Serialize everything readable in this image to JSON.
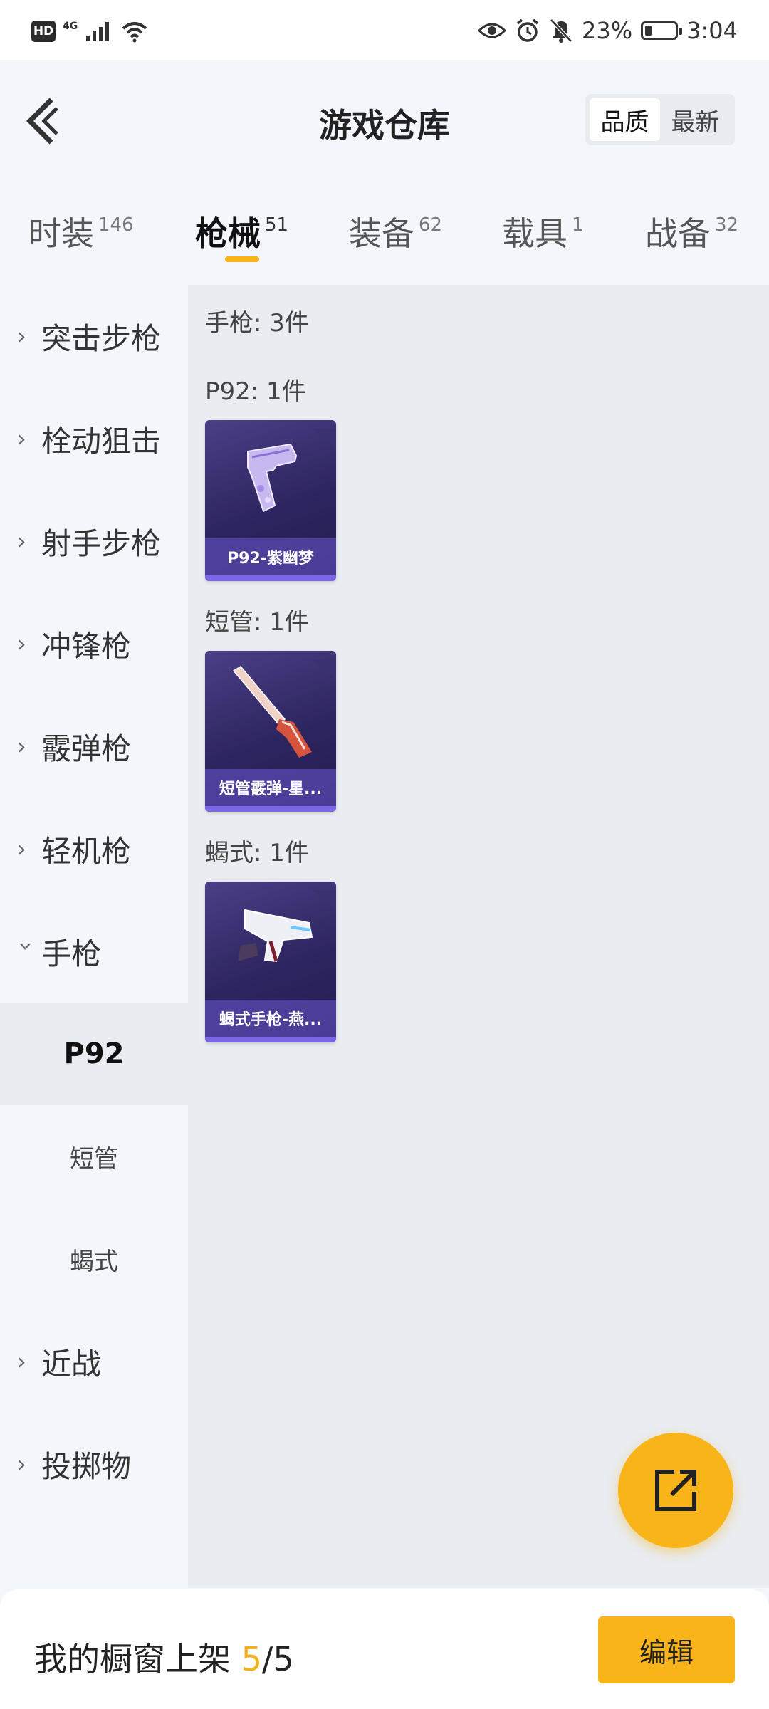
{
  "status_bar": {
    "hd_label": "HD",
    "network_label": "4G",
    "battery_percent": "23%",
    "battery_level": 0.23,
    "time": "3:04",
    "icons": [
      "signal-icon",
      "wifi-icon",
      "eye-icon",
      "alarm-icon",
      "bell-off-icon",
      "battery-icon"
    ]
  },
  "header": {
    "title": "游戏仓库",
    "sort_options": [
      {
        "label": "品质",
        "active": true
      },
      {
        "label": "最新",
        "active": false
      }
    ]
  },
  "tabs": [
    {
      "label": "时装",
      "count": "146",
      "active": false
    },
    {
      "label": "枪械",
      "count": "51",
      "active": true
    },
    {
      "label": "装备",
      "count": "62",
      "active": false
    },
    {
      "label": "载具",
      "count": "1",
      "active": false
    },
    {
      "label": "战备",
      "count": "32",
      "active": false
    }
  ],
  "sidebar": {
    "items": [
      {
        "label": "突击步枪",
        "expanded": false
      },
      {
        "label": "栓动狙击",
        "expanded": false
      },
      {
        "label": "射手步枪",
        "expanded": false
      },
      {
        "label": "冲锋枪",
        "expanded": false
      },
      {
        "label": "霰弹枪",
        "expanded": false
      },
      {
        "label": "轻机枪",
        "expanded": false
      },
      {
        "label": "手枪",
        "expanded": true
      }
    ],
    "sub_items": [
      {
        "label": "P92",
        "active": true
      },
      {
        "label": "短管",
        "active": false
      },
      {
        "label": "蝎式",
        "active": false
      }
    ],
    "items_after": [
      {
        "label": "近战",
        "expanded": false
      },
      {
        "label": "投掷物",
        "expanded": false
      }
    ]
  },
  "content": {
    "category_summary": "手枪: 3件",
    "groups": [
      {
        "title": "P92: 1件",
        "item_name": "P92-紫幽梦",
        "art": "pistol-purple"
      },
      {
        "title": "短管: 1件",
        "item_name": "短管霰弹-星...",
        "art": "shotgun-red"
      },
      {
        "title": "蝎式: 1件",
        "item_name": "蝎式手枪-燕...",
        "art": "smg-white"
      }
    ]
  },
  "bottom_bar": {
    "showcase_label": "我的橱窗上架",
    "showcase_current": "5",
    "showcase_total": "/5",
    "edit_label": "编辑"
  },
  "colors": {
    "accent": "#f9b41a",
    "card_bg": "#2d2560",
    "caption_bg": "#6c58d2"
  }
}
